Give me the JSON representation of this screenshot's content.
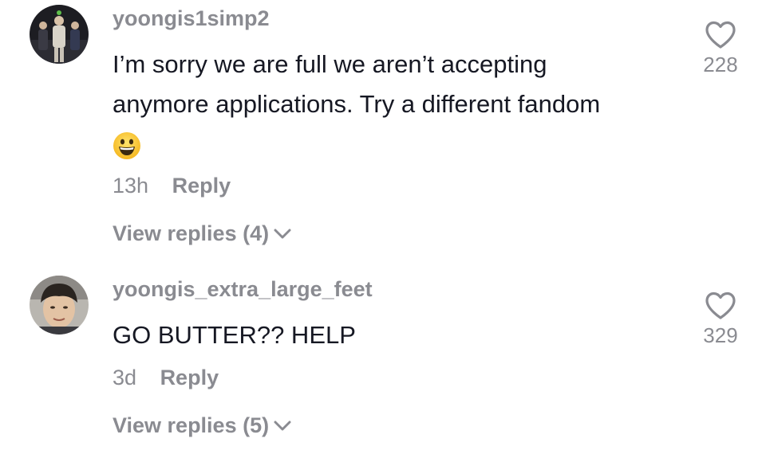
{
  "comments": [
    {
      "username": "yoongis1simp2",
      "text_lines": [
        "I’m sorry we are full we aren’t accepting",
        "anymore applications. Try a different fandom"
      ],
      "emoji": "grinning-face",
      "time": "13h",
      "reply_label": "Reply",
      "view_replies": "View replies (4)",
      "likes": "228"
    },
    {
      "username": "yoongis_extra_large_feet",
      "text_lines": [
        "GO BUTTER?? HELP"
      ],
      "time": "3d",
      "reply_label": "Reply",
      "view_replies": "View replies (5)",
      "likes": "329"
    }
  ],
  "icons": {
    "like": "heart-outline-icon",
    "expand": "chevron-down-icon"
  },
  "colors": {
    "primary_text": "#161823",
    "secondary_text": "#8a8b91",
    "background": "#ffffff"
  }
}
